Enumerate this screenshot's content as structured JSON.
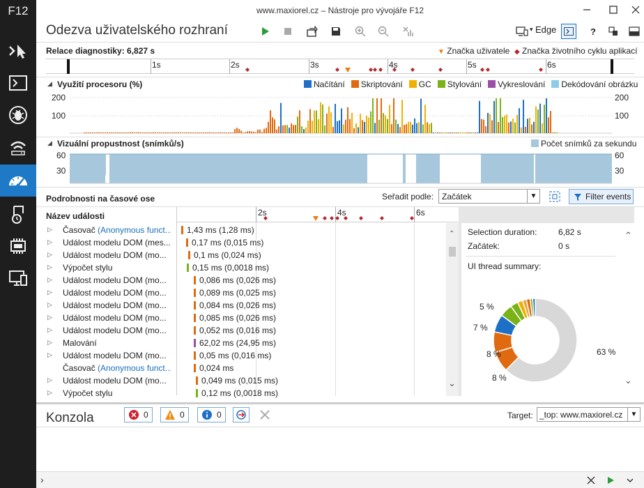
{
  "sidebar": {
    "app_label": "F12"
  },
  "window": {
    "title": "www.maxiorel.cz – Nástroje pro vývojáře F12"
  },
  "header": {
    "title": "Odezva uživatelského rozhraní",
    "browser_label": "Edge"
  },
  "session": {
    "label": "Relace diagnostiky: 6,827 s",
    "legend_user": "Značka uživatele",
    "legend_lifecycle": "Značka životního cyklu aplikací",
    "ticks": [
      "1s",
      "2s",
      "3s",
      "4s",
      "5s",
      "6s"
    ]
  },
  "cpu": {
    "title": "Využití procesoru (%)",
    "legend": [
      {
        "label": "Načítání",
        "color": "#1e6fc6"
      },
      {
        "label": "Skriptování",
        "color": "#e06a10"
      },
      {
        "label": "GC",
        "color": "#f0b000"
      },
      {
        "label": "Stylování",
        "color": "#7ab317"
      },
      {
        "label": "Vykreslování",
        "color": "#9b4ea8"
      },
      {
        "label": "Dekódování obrázku",
        "color": "#8ccbe9"
      }
    ],
    "y_top": "200",
    "y_mid": "100"
  },
  "throughput": {
    "title": "Vizuální propustnost (snímků/s)",
    "legend": "Počet snímků za sekundu",
    "y_top": "60",
    "y_mid": "30"
  },
  "details": {
    "title": "Podrobnosti na časové ose",
    "sort_label": "Seřadit podle:",
    "sort_value": "Začátek",
    "filter_label": "Filter events",
    "col_header": "Název události",
    "ticks": [
      "2s",
      "4s",
      "6s"
    ],
    "events": [
      {
        "name": "Časovač ",
        "link": "(Anonymous funct...",
        "value": "1,43 ms (1,28 ms)",
        "color": "#e06a10",
        "tri": true
      },
      {
        "name": "Událost modelu DOM (mes...",
        "link": "",
        "value": "0,17 ms (0,015 ms)",
        "color": "#e06a10",
        "tri": true
      },
      {
        "name": "Událost modelu DOM (mo...",
        "link": "",
        "value": "0,1 ms (0,024 ms)",
        "color": "#e06a10",
        "tri": true
      },
      {
        "name": "Výpočet stylu",
        "link": "",
        "value": "0,15 ms (0,0018 ms)",
        "color": "#7ab317",
        "tri": true
      },
      {
        "name": "Událost modelu DOM (mo...",
        "link": "",
        "value": "0,086 ms (0,026 ms)",
        "color": "#e06a10",
        "tri": true
      },
      {
        "name": "Událost modelu DOM (mo...",
        "link": "",
        "value": "0,089 ms (0,025 ms)",
        "color": "#e06a10",
        "tri": true
      },
      {
        "name": "Událost modelu DOM (mo...",
        "link": "",
        "value": "0,084 ms (0,026 ms)",
        "color": "#e06a10",
        "tri": true
      },
      {
        "name": "Událost modelu DOM (mo...",
        "link": "",
        "value": "0,085 ms (0,026 ms)",
        "color": "#e06a10",
        "tri": true
      },
      {
        "name": "Událost modelu DOM (mo...",
        "link": "",
        "value": "0,052 ms (0,016 ms)",
        "color": "#e06a10",
        "tri": true
      },
      {
        "name": "Malování",
        "link": "",
        "value": "62,02 ms (24,95 ms)",
        "color": "#9b4ea8",
        "tri": true
      },
      {
        "name": "Událost modelu DOM (mo...",
        "link": "",
        "value": "0,05 ms (0,016 ms)",
        "color": "#e06a10",
        "tri": true
      },
      {
        "name": "Časovač ",
        "link": "(Anonymous funct...",
        "value": "0,024 ms",
        "color": "#e06a10",
        "tri": false
      },
      {
        "name": "Událost modelu DOM (mo...",
        "link": "",
        "value": "0,049 ms (0,015 ms)",
        "color": "#e06a10",
        "tri": true
      },
      {
        "name": "Výpočet stylu",
        "link": "",
        "value": "0,12 ms (0,0018 ms)",
        "color": "#7ab317",
        "tri": true
      }
    ]
  },
  "summary": {
    "selection_label": "Selection duration:",
    "selection_value": "6,82 s",
    "start_label": "Začátek:",
    "start_value": "0 s",
    "thread_label": "UI thread summary:",
    "slices": [
      {
        "label": "63 %",
        "value": 63,
        "color": "#d8d8d8"
      },
      {
        "label": "8 %",
        "value": 8,
        "color": "#e06a10"
      },
      {
        "label": "8 %",
        "value": 8,
        "color": "#e06a10"
      },
      {
        "label": "7 %",
        "value": 7,
        "color": "#1e6fc6"
      },
      {
        "label": "5 %",
        "value": 5,
        "color": "#7ab317"
      },
      {
        "label": "",
        "value": 3,
        "color": "#7ab317"
      },
      {
        "label": "",
        "value": 2,
        "color": "#f0b000"
      },
      {
        "label": "",
        "value": 1.5,
        "color": "#f0a030"
      },
      {
        "label": "",
        "value": 1.5,
        "color": "#e06a10"
      },
      {
        "label": "",
        "value": 1,
        "color": "#7ab317"
      },
      {
        "label": "",
        "value": 1,
        "color": "#1e6fc6"
      }
    ]
  },
  "console": {
    "title": "Konzola",
    "errors": "0",
    "warnings": "0",
    "info": "0",
    "target_label": "Target:",
    "target_value": "_top: www.maxiorel.cz"
  }
}
